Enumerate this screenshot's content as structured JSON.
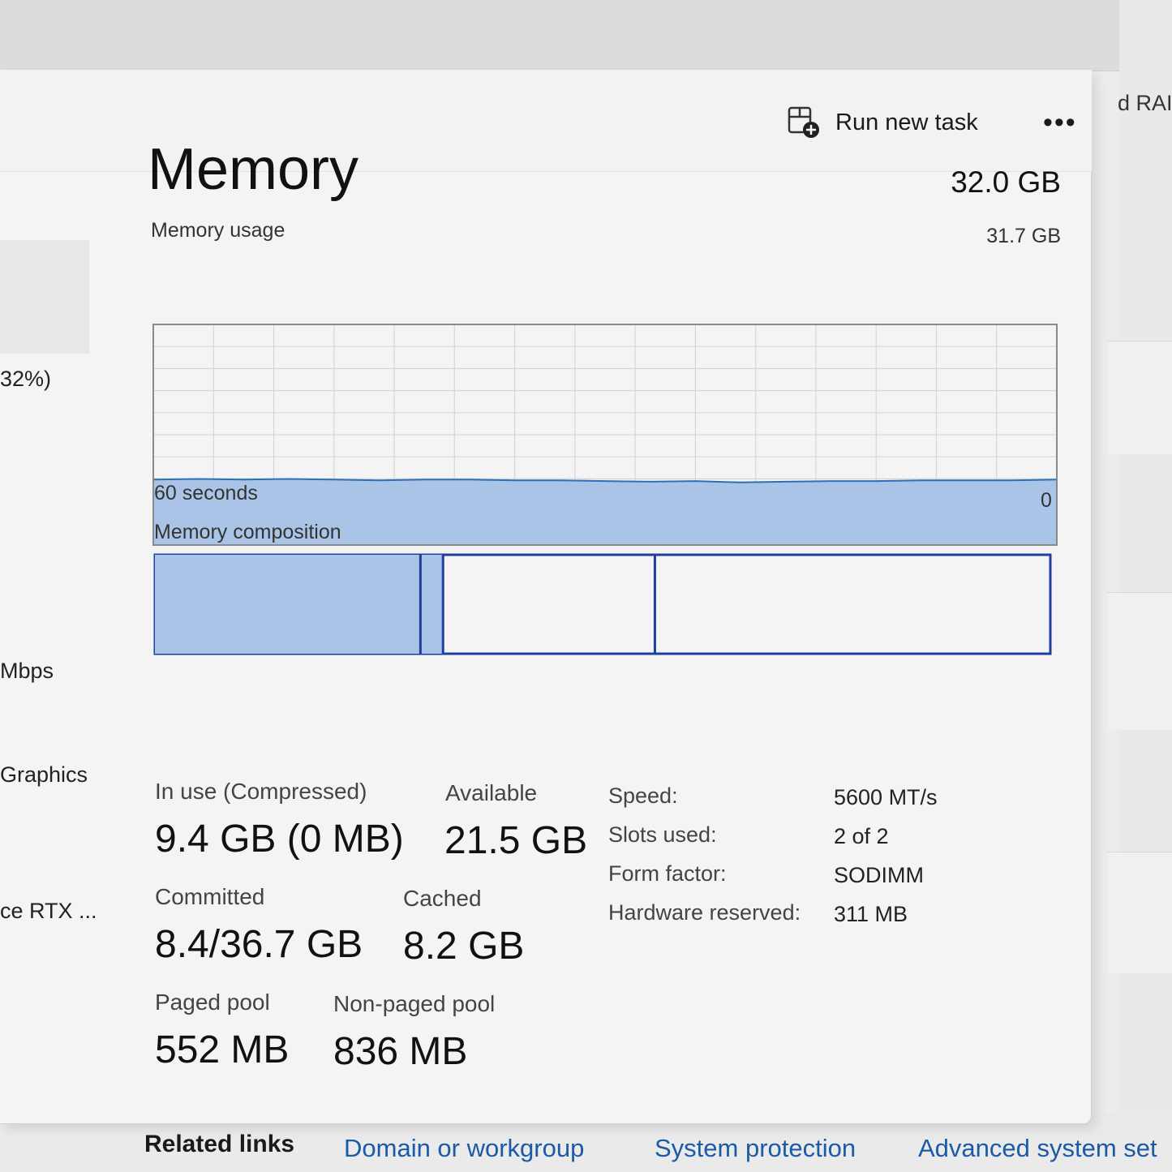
{
  "background": {
    "right_text": "d RAI",
    "related_links_label": "Related links",
    "links": [
      "Domain or workgroup",
      "System protection",
      "Advanced system set"
    ]
  },
  "toolbar": {
    "run_new_task": "Run new task",
    "more_label": "•••"
  },
  "sidebar": {
    "items": [
      "32%)",
      "Mbps",
      "Graphics",
      "ce RTX ..."
    ]
  },
  "memory": {
    "title": "Memory",
    "total": "32.0 GB",
    "usage_label": "Memory usage",
    "usage_max": "31.7 GB",
    "axis_left": "60 seconds",
    "axis_right": "0",
    "composition_label": "Memory composition",
    "stats": {
      "in_use_label": "In use (Compressed)",
      "in_use_value": "9.4 GB (0 MB)",
      "available_label": "Available",
      "available_value": "21.5 GB",
      "committed_label": "Committed",
      "committed_value": "8.4/36.7 GB",
      "cached_label": "Cached",
      "cached_value": "8.2 GB",
      "paged_label": "Paged pool",
      "paged_value": "552 MB",
      "nonpaged_label": "Non-paged pool",
      "nonpaged_value": "836 MB"
    },
    "specs": {
      "speed_label": "Speed:",
      "speed_value": "5600 MT/s",
      "slots_label": "Slots used:",
      "slots_value": "2 of 2",
      "form_label": "Form factor:",
      "form_value": "SODIMM",
      "reserved_label": "Hardware reserved:",
      "reserved_value": "311 MB"
    }
  },
  "chart_data": {
    "type": "area",
    "xlim": [
      60,
      0
    ],
    "ylim": [
      0,
      31.7
    ],
    "x": [
      60,
      57,
      54,
      51,
      48,
      45,
      42,
      39,
      36,
      33,
      30,
      27,
      24,
      21,
      18,
      15,
      12,
      9,
      6,
      3,
      0
    ],
    "values": [
      9.4,
      9.5,
      9.4,
      9.5,
      9.4,
      9.3,
      9.4,
      9.4,
      9.3,
      9.3,
      9.2,
      9.1,
      9.2,
      9.0,
      9.1,
      9.2,
      9.2,
      9.3,
      9.3,
      9.3,
      9.4
    ],
    "composition": {
      "in_use": 9.4,
      "modified": 0.8,
      "standby": 7.5,
      "free": 14.0
    },
    "colors": {
      "fill": "#a9c4e6",
      "line": "#2f6fb5",
      "border": "#1f3fa0",
      "grid": "#d6d6d6"
    }
  }
}
